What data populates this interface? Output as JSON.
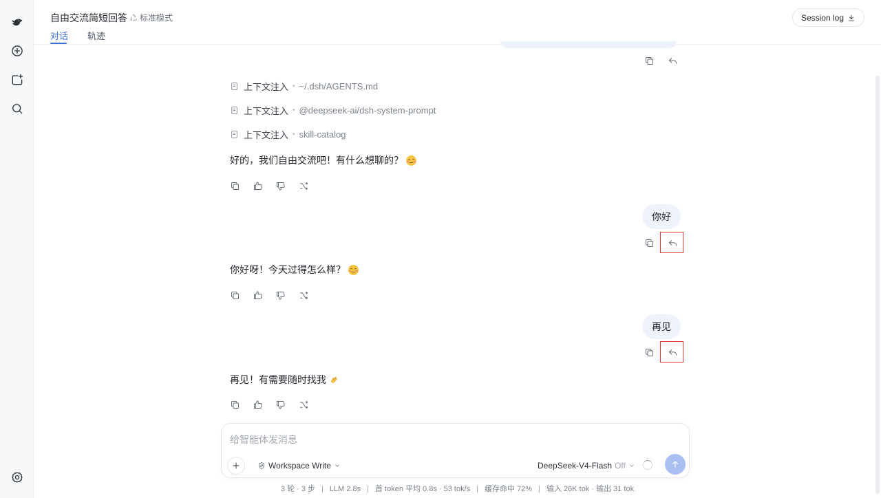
{
  "header": {
    "title": "自由交流简短回答",
    "mode": "标准模式",
    "tabs": [
      {
        "label": "对话",
        "active": true
      },
      {
        "label": "轨迹",
        "active": false
      }
    ],
    "session_log_label": "Session log"
  },
  "sidebar": {
    "items": [
      {
        "icon": "whale-logo-icon"
      },
      {
        "icon": "new-chat-icon"
      },
      {
        "icon": "add-folder-icon"
      },
      {
        "icon": "search-icon"
      },
      {
        "icon": "settings-icon"
      }
    ]
  },
  "conversation": {
    "context_injections": [
      {
        "label": "上下文注入",
        "value": "~/.dsh/AGENTS.md"
      },
      {
        "label": "上下文注入",
        "value": "@deepseek-ai/dsh-system-prompt"
      },
      {
        "label": "上下文注入",
        "value": "skill-catalog"
      }
    ],
    "messages": [
      {
        "role": "assistant",
        "text": "好的，我们自由交流吧！有什么想聊的？",
        "emoji": "smiling-face"
      },
      {
        "role": "user",
        "text": "你好"
      },
      {
        "role": "assistant",
        "text": "你好呀！今天过得怎么样？",
        "emoji": "smiling-face"
      },
      {
        "role": "user",
        "text": "再见"
      },
      {
        "role": "assistant",
        "text": "再见！有需要随时找我",
        "emoji": "waving-hand"
      }
    ]
  },
  "composer": {
    "placeholder": "给智能体发消息",
    "workspace_label": "Workspace Write",
    "model_label": "DeepSeek-V4-Flash",
    "model_toggle": "Off"
  },
  "footer": {
    "items": [
      "3 轮 · 3 步",
      "LLM 2.8s",
      "首 token 平均 0.8s · 53 tok/s",
      "缓存命中 72%",
      "输入 26K tok · 输出 31 tok"
    ]
  },
  "colors": {
    "accent": "#3b6fd8",
    "user_bubble": "#eef2fb",
    "send_button": "#a9bff2",
    "highlight_box": "#e53935"
  }
}
